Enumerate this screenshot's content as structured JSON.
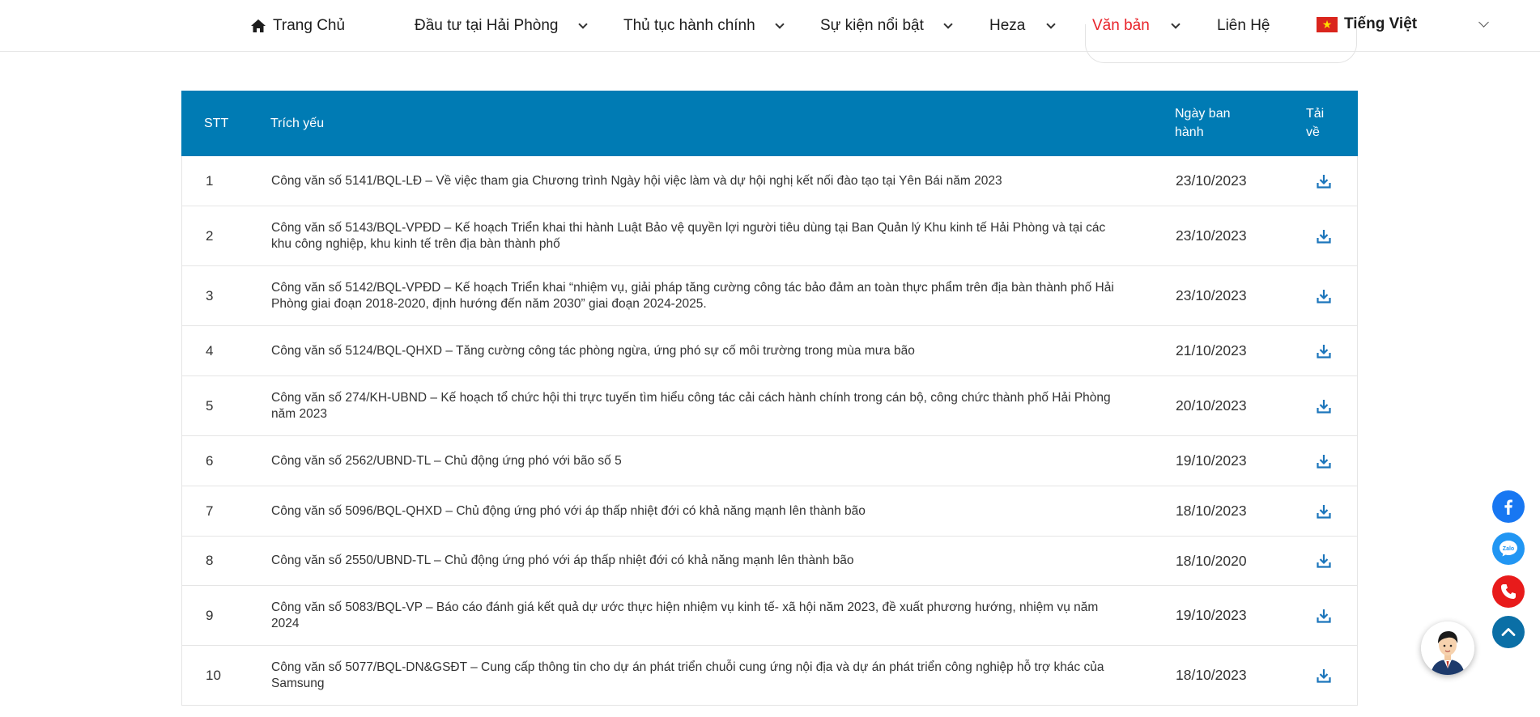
{
  "nav": {
    "home": "Trang Chủ",
    "items": [
      {
        "label": "Đầu tư tại Hải Phòng"
      },
      {
        "label": "Thủ tục hành chính"
      },
      {
        "label": "Sự kiện nổi bật"
      },
      {
        "label": "Heza"
      },
      {
        "label": "Văn bản"
      }
    ],
    "contact": "Liên Hệ",
    "language": "Tiếng Việt",
    "active_color": "#e8232a"
  },
  "table": {
    "headers": {
      "stt": "STT",
      "summary": "Trích yếu",
      "date_line1": "Ngày ban",
      "date_line2": "hành",
      "download_line1": "Tải",
      "download_line2": "về"
    },
    "header_color": "#007bb4",
    "rows": [
      {
        "stt": "1",
        "summary": "Công văn số 5141/BQL-LĐ – Về việc tham gia Chương trình Ngày hội việc làm và dự hội nghị kết nối đào tạo tại Yên Bái năm 2023",
        "date": "23/10/2023",
        "icon": "download-icon"
      },
      {
        "stt": "2",
        "summary": "Công văn số 5143/BQL-VPĐD – Kế hoạch Triển khai thi hành Luật Bảo vệ quyền lợi người tiêu dùng tại Ban Quản lý Khu kinh tế Hải Phòng và tại các khu công nghiệp, khu kinh tế trên địa bàn thành phố",
        "date": "23/10/2023",
        "icon": "download-icon"
      },
      {
        "stt": "3",
        "summary": "Công văn số 5142/BQL-VPĐD – Kế hoạch Triển khai “nhiệm vụ, giải pháp tăng cường công tác bảo đảm an toàn thực phẩm trên địa bàn thành phố Hải Phòng giai đoạn 2018-2020, định hướng đến năm 2030” giai đoạn 2024-2025.",
        "date": "23/10/2023",
        "icon": "download-icon"
      },
      {
        "stt": "4",
        "summary": "Công văn số 5124/BQL-QHXD – Tăng cường công tác phòng ngừa, ứng phó sự cố môi trường trong mùa mưa bão",
        "date": "21/10/2023",
        "icon": "download-icon"
      },
      {
        "stt": "5",
        "summary": "Công văn số 274/KH-UBND – Kế hoạch tổ chức hội thi trực tuyến tìm hiểu công tác cải cách hành chính trong cán bộ, công chức thành phố Hải Phòng năm 2023",
        "date": "20/10/2023",
        "icon": "download-icon"
      },
      {
        "stt": "6",
        "summary": "Công văn số 2562/UBND-TL – Chủ động ứng phó với bão số 5",
        "date": "19/10/2023",
        "icon": "download-icon"
      },
      {
        "stt": "7",
        "summary": "Công văn số 5096/BQL-QHXD – Chủ động ứng phó với áp thấp nhiệt đới có khả năng mạnh lên thành bão",
        "date": "18/10/2023",
        "icon": "download-icon"
      },
      {
        "stt": "8",
        "summary": "Công văn số 2550/UBND-TL – Chủ động ứng phó với áp thấp nhiệt đới có khả năng mạnh lên thành bão",
        "date": "18/10/2020",
        "icon": "download-icon"
      },
      {
        "stt": "9",
        "summary": "Công văn số 5083/BQL-VP – Báo cáo đánh giá kết quả dự ước thực hiện nhiệm vụ kinh tế- xã hội năm 2023, đề xuất phương hướng, nhiệm vụ năm 2024",
        "date": "19/10/2023",
        "icon": "download-icon"
      },
      {
        "stt": "10",
        "summary": "Công văn số 5077/BQL-DN&GSĐT – Cung cấp thông tin cho dự án phát triển chuỗi cung ứng nội địa và dự án phát triển công nghiệp hỗ trợ khác của Samsung",
        "date": "18/10/2023",
        "icon": "download-icon"
      }
    ]
  },
  "floating": {
    "facebook_icon": "facebook-icon",
    "zalo_icon": "zalo-icon",
    "zalo_text": "Zalo",
    "phone_icon": "phone-icon",
    "top_icon": "chevron-up-icon",
    "avatar_icon": "support-avatar-icon"
  }
}
